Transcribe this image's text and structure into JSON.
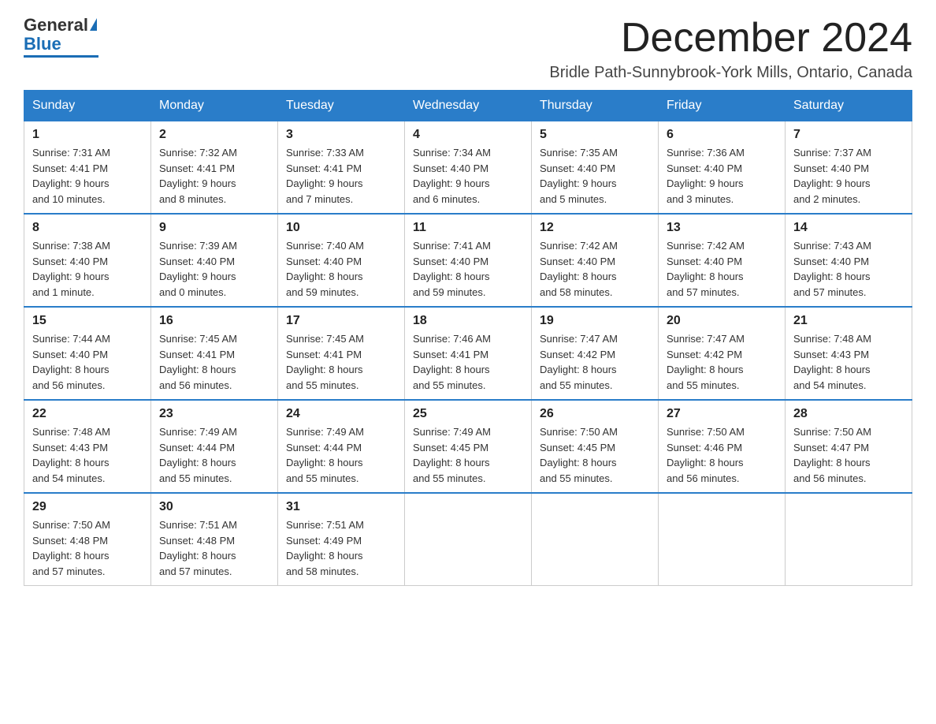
{
  "logo": {
    "text_general": "General",
    "text_blue": "Blue"
  },
  "header": {
    "month": "December 2024",
    "location": "Bridle Path-Sunnybrook-York Mills, Ontario, Canada"
  },
  "days_of_week": [
    "Sunday",
    "Monday",
    "Tuesday",
    "Wednesday",
    "Thursday",
    "Friday",
    "Saturday"
  ],
  "weeks": [
    [
      {
        "day": "1",
        "sunrise": "7:31 AM",
        "sunset": "4:41 PM",
        "daylight": "9 hours and 10 minutes."
      },
      {
        "day": "2",
        "sunrise": "7:32 AM",
        "sunset": "4:41 PM",
        "daylight": "9 hours and 8 minutes."
      },
      {
        "day": "3",
        "sunrise": "7:33 AM",
        "sunset": "4:41 PM",
        "daylight": "9 hours and 7 minutes."
      },
      {
        "day": "4",
        "sunrise": "7:34 AM",
        "sunset": "4:40 PM",
        "daylight": "9 hours and 6 minutes."
      },
      {
        "day": "5",
        "sunrise": "7:35 AM",
        "sunset": "4:40 PM",
        "daylight": "9 hours and 5 minutes."
      },
      {
        "day": "6",
        "sunrise": "7:36 AM",
        "sunset": "4:40 PM",
        "daylight": "9 hours and 3 minutes."
      },
      {
        "day": "7",
        "sunrise": "7:37 AM",
        "sunset": "4:40 PM",
        "daylight": "9 hours and 2 minutes."
      }
    ],
    [
      {
        "day": "8",
        "sunrise": "7:38 AM",
        "sunset": "4:40 PM",
        "daylight": "9 hours and 1 minute."
      },
      {
        "day": "9",
        "sunrise": "7:39 AM",
        "sunset": "4:40 PM",
        "daylight": "9 hours and 0 minutes."
      },
      {
        "day": "10",
        "sunrise": "7:40 AM",
        "sunset": "4:40 PM",
        "daylight": "8 hours and 59 minutes."
      },
      {
        "day": "11",
        "sunrise": "7:41 AM",
        "sunset": "4:40 PM",
        "daylight": "8 hours and 59 minutes."
      },
      {
        "day": "12",
        "sunrise": "7:42 AM",
        "sunset": "4:40 PM",
        "daylight": "8 hours and 58 minutes."
      },
      {
        "day": "13",
        "sunrise": "7:42 AM",
        "sunset": "4:40 PM",
        "daylight": "8 hours and 57 minutes."
      },
      {
        "day": "14",
        "sunrise": "7:43 AM",
        "sunset": "4:40 PM",
        "daylight": "8 hours and 57 minutes."
      }
    ],
    [
      {
        "day": "15",
        "sunrise": "7:44 AM",
        "sunset": "4:40 PM",
        "daylight": "8 hours and 56 minutes."
      },
      {
        "day": "16",
        "sunrise": "7:45 AM",
        "sunset": "4:41 PM",
        "daylight": "8 hours and 56 minutes."
      },
      {
        "day": "17",
        "sunrise": "7:45 AM",
        "sunset": "4:41 PM",
        "daylight": "8 hours and 55 minutes."
      },
      {
        "day": "18",
        "sunrise": "7:46 AM",
        "sunset": "4:41 PM",
        "daylight": "8 hours and 55 minutes."
      },
      {
        "day": "19",
        "sunrise": "7:47 AM",
        "sunset": "4:42 PM",
        "daylight": "8 hours and 55 minutes."
      },
      {
        "day": "20",
        "sunrise": "7:47 AM",
        "sunset": "4:42 PM",
        "daylight": "8 hours and 55 minutes."
      },
      {
        "day": "21",
        "sunrise": "7:48 AM",
        "sunset": "4:43 PM",
        "daylight": "8 hours and 54 minutes."
      }
    ],
    [
      {
        "day": "22",
        "sunrise": "7:48 AM",
        "sunset": "4:43 PM",
        "daylight": "8 hours and 54 minutes."
      },
      {
        "day": "23",
        "sunrise": "7:49 AM",
        "sunset": "4:44 PM",
        "daylight": "8 hours and 55 minutes."
      },
      {
        "day": "24",
        "sunrise": "7:49 AM",
        "sunset": "4:44 PM",
        "daylight": "8 hours and 55 minutes."
      },
      {
        "day": "25",
        "sunrise": "7:49 AM",
        "sunset": "4:45 PM",
        "daylight": "8 hours and 55 minutes."
      },
      {
        "day": "26",
        "sunrise": "7:50 AM",
        "sunset": "4:45 PM",
        "daylight": "8 hours and 55 minutes."
      },
      {
        "day": "27",
        "sunrise": "7:50 AM",
        "sunset": "4:46 PM",
        "daylight": "8 hours and 56 minutes."
      },
      {
        "day": "28",
        "sunrise": "7:50 AM",
        "sunset": "4:47 PM",
        "daylight": "8 hours and 56 minutes."
      }
    ],
    [
      {
        "day": "29",
        "sunrise": "7:50 AM",
        "sunset": "4:48 PM",
        "daylight": "8 hours and 57 minutes."
      },
      {
        "day": "30",
        "sunrise": "7:51 AM",
        "sunset": "4:48 PM",
        "daylight": "8 hours and 57 minutes."
      },
      {
        "day": "31",
        "sunrise": "7:51 AM",
        "sunset": "4:49 PM",
        "daylight": "8 hours and 58 minutes."
      },
      null,
      null,
      null,
      null
    ]
  ],
  "labels": {
    "sunrise": "Sunrise:",
    "sunset": "Sunset:",
    "daylight": "Daylight:"
  }
}
